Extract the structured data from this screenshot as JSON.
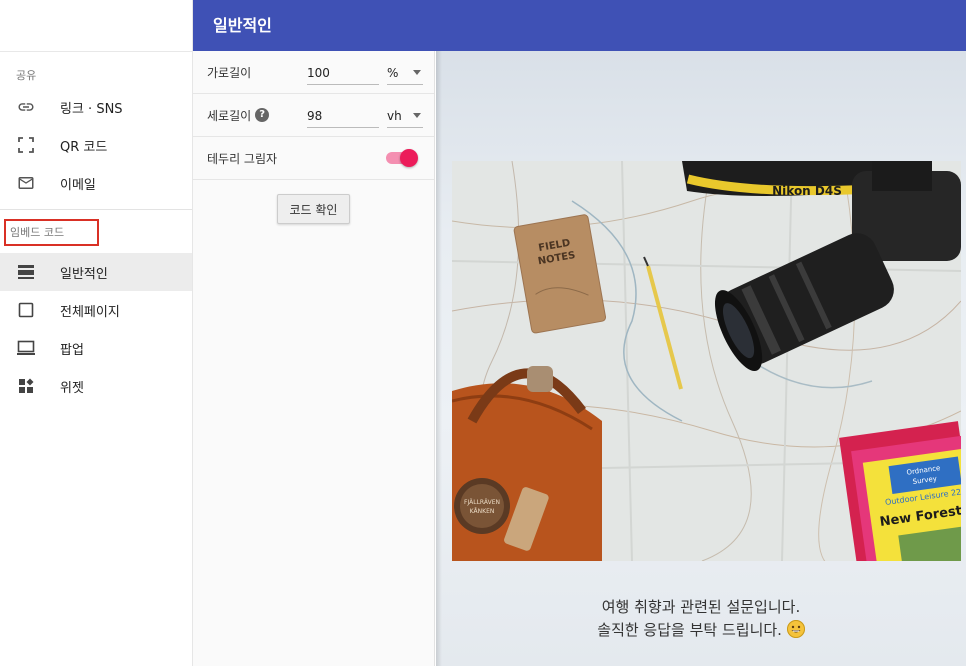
{
  "header": {
    "title": "일반적인"
  },
  "sidebar": {
    "share_label": "공유",
    "share_items": [
      {
        "label": "링크 · SNS",
        "icon": "link-icon"
      },
      {
        "label": "QR 코드",
        "icon": "qr-scan-icon"
      },
      {
        "label": "이메일",
        "icon": "mail-icon"
      }
    ],
    "embed_label": "임베드 코드",
    "embed_items": [
      {
        "label": "일반적인",
        "icon": "general-layout-icon",
        "active": true
      },
      {
        "label": "전체페이지",
        "icon": "fullpage-icon"
      },
      {
        "label": "팝업",
        "icon": "popup-icon"
      },
      {
        "label": "위젯",
        "icon": "widget-icon"
      }
    ]
  },
  "settings": {
    "width": {
      "label": "가로길이",
      "value": "100",
      "unit": "%"
    },
    "height": {
      "label": "세로길이",
      "value": "98",
      "unit": "vh"
    },
    "shadow": {
      "label": "테두리 그림자",
      "enabled": true
    },
    "confirm_button": "코드 확인"
  },
  "preview": {
    "caption_line1": "여행 취향과 관련된 설문입니다.",
    "caption_line2": "솔직한 응답을 부탁 드립니다.",
    "photo_texts": {
      "notebook": "FIELD NOTES",
      "strap": "Nikon D4S",
      "map_top": "Ordnance Survey",
      "map_sub": "Outdoor Leisure 22",
      "map_title": "New Forest",
      "bag_logo": "FJÄLLRÄVEN KÅNKEN"
    }
  },
  "colors": {
    "header": "#3f51b5",
    "toggle_accent": "#ec1c5a",
    "highlight_border": "#d93025"
  }
}
